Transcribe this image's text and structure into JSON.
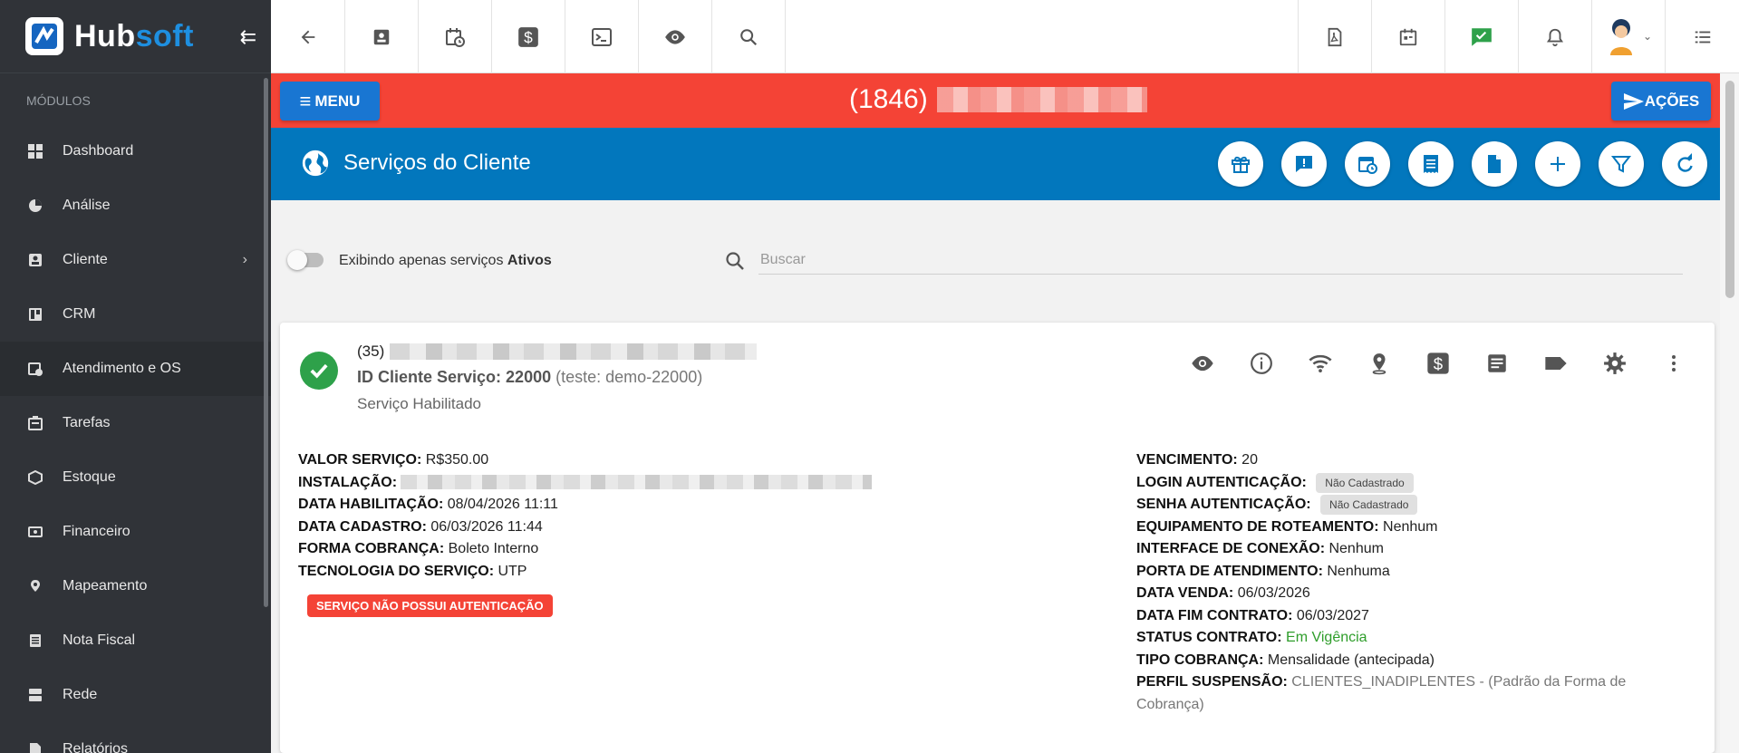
{
  "brand": {
    "name_part1": "Hub",
    "name_part2": "soft"
  },
  "sidebar": {
    "section_title": "MÓDULOS",
    "items": [
      {
        "label": "Dashboard",
        "icon": "dashboard-icon"
      },
      {
        "label": "Análise",
        "icon": "pie-chart-icon"
      },
      {
        "label": "Cliente",
        "icon": "contact-icon"
      },
      {
        "label": "CRM",
        "icon": "board-icon"
      },
      {
        "label": "Atendimento e OS",
        "icon": "calendar-clock-icon"
      },
      {
        "label": "Tarefas",
        "icon": "tasks-icon"
      },
      {
        "label": "Estoque",
        "icon": "box-icon"
      },
      {
        "label": "Financeiro",
        "icon": "money-icon"
      },
      {
        "label": "Mapeamento",
        "icon": "map-pin-icon"
      },
      {
        "label": "Nota Fiscal",
        "icon": "document-icon"
      },
      {
        "label": "Rede",
        "icon": "server-icon"
      },
      {
        "label": "Relatórios",
        "icon": "report-icon"
      }
    ]
  },
  "header": {
    "menu_label": "MENU",
    "client_code": "(1846)",
    "acoes_label": "AÇÕES"
  },
  "section": {
    "title": "Serviços do Cliente"
  },
  "filter": {
    "toggle_text": "Exibindo apenas serviços ",
    "toggle_bold": "Ativos",
    "search_placeholder": "Buscar"
  },
  "service": {
    "name_prefix": "(35)",
    "id_label": "ID Cliente Serviço: 22000",
    "id_extra": "(teste: demo-22000)",
    "status": "Serviço Habilitado",
    "alert": "SERVIÇO NÃO POSSUI AUTENTICAÇÃO",
    "left_fields": [
      {
        "label": "VALOR SERVIÇO:",
        "value": "R$350.00"
      },
      {
        "label": "INSTALAÇÃO:",
        "value": ""
      },
      {
        "label": "DATA HABILITAÇÃO:",
        "value": "08/04/2026 11:11"
      },
      {
        "label": "DATA CADASTRO:",
        "value": "06/03/2026 11:44"
      },
      {
        "label": "FORMA COBRANÇA:",
        "value": "Boleto Interno"
      },
      {
        "label": "TECNOLOGIA DO SERVIÇO:",
        "value": "UTP"
      }
    ],
    "right_fields": {
      "vencimento": {
        "label": "VENCIMENTO:",
        "value": "20"
      },
      "login": {
        "label": "LOGIN AUTENTICAÇÃO:",
        "chip": "Não Cadastrado"
      },
      "senha": {
        "label": "SENHA AUTENTICAÇÃO:",
        "chip": "Não Cadastrado"
      },
      "equip": {
        "label": "EQUIPAMENTO DE ROTEAMENTO:",
        "value": "Nenhum"
      },
      "interface": {
        "label": "INTERFACE DE CONEXÃO:",
        "value": "Nenhum"
      },
      "porta": {
        "label": "PORTA DE ATENDIMENTO:",
        "value": "Nenhuma"
      },
      "venda": {
        "label": "DATA VENDA:",
        "value": "06/03/2026"
      },
      "fim": {
        "label": "DATA FIM CONTRATO:",
        "value": "06/03/2027"
      },
      "status": {
        "label": "STATUS CONTRATO:",
        "value": "Em Vigência"
      },
      "tipo": {
        "label": "TIPO COBRANÇA:",
        "value": "Mensalidade (antecipada)"
      },
      "perfil": {
        "label": "PERFIL SUSPENSÃO:",
        "value": "CLIENTES_INADIPLENTES - (Padrão da Forma de Cobrança)"
      }
    }
  },
  "colors": {
    "red": "#f44336",
    "blue": "#0277bd",
    "button_blue": "#1976d2",
    "sidebar": "#303338",
    "green": "#2ea14a"
  }
}
